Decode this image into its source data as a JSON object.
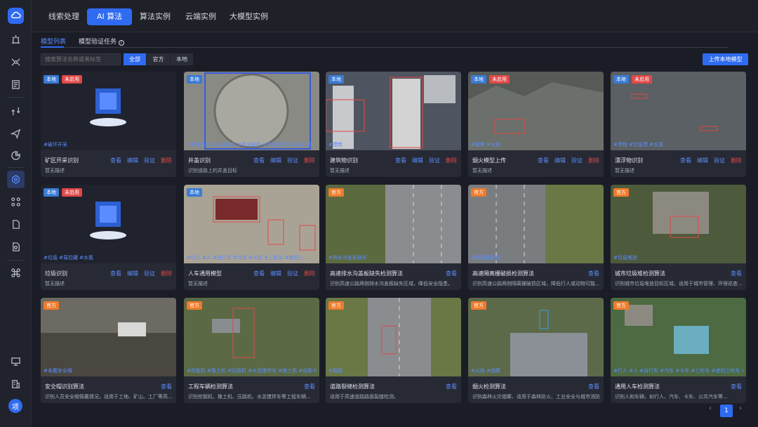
{
  "app": {
    "avatar": "项"
  },
  "topnav": [
    "线索处理",
    "AI 算法",
    "算法实例",
    "云端实例",
    "大模型实例"
  ],
  "subtabs": [
    "模型列表",
    "模型验证任务"
  ],
  "search": {
    "placeholder": "搜索算法名称或者标签"
  },
  "filters": [
    "全部",
    "官方",
    "本地"
  ],
  "upload_label": "上传本地模型",
  "badges": {
    "local": "本地",
    "disabled": "未启用",
    "official": "官方"
  },
  "actions": {
    "view": "查看",
    "edit": "编辑",
    "verify": "验证",
    "delete": "删除"
  },
  "cards": [
    {
      "name": "矿区开采识别",
      "desc": "暂无描述",
      "tags": "#破坏开采",
      "type": "local"
    },
    {
      "name": "井盖识别",
      "desc": "识别道路上的井盖目标",
      "tags": "#井盖移位 #井盖缺失 #井盖破损 #井盖损坏 #井盖开启",
      "type": "local"
    },
    {
      "name": "建筑物识别",
      "desc": "暂无描述",
      "tags": "#建筑",
      "type": "local"
    },
    {
      "name": "烟火模型上传",
      "desc": "暂无描述",
      "tags": "#烟雾 #火焰",
      "type": "local"
    },
    {
      "name": "漂浮物识别",
      "desc": "暂无描述",
      "tags": "#漂物 #垃圾漂 #水藻",
      "type": "local"
    },
    {
      "name": "垃圾识别",
      "desc": "暂无描述",
      "tags": "#垃圾 #易拉罐 #水瓶",
      "type": "local"
    },
    {
      "name": "人车通用模型",
      "desc": "暂无描述",
      "tags": "#行人 #人 #自行车 #汽车 #卡车 #三轮车 #遮阳三...",
      "type": "local"
    },
    {
      "name": "高速排水沟盖板缺失检测算法",
      "desc": "识别高速公路两侧排水沟盖板缺失区域，降低安全隐患。",
      "tags": "#排水沟盖板缺失",
      "type": "official"
    },
    {
      "name": "高速隔离栅破损检测算法",
      "desc": "识别高速公路两侧隔离栅破损区域，降低行人或动物可能...",
      "tags": "#隔离栅破损",
      "type": "official"
    },
    {
      "name": "城市垃圾堆检测算法",
      "desc": "识别城市垃圾堆放目标区域，适用于城市管理、环保巡查...",
      "tags": "#垃圾堆放",
      "type": "official"
    },
    {
      "name": "安全帽识别算法",
      "desc": "识别人员安全帽佩戴情况，适用于工地、矿山、工厂等高...",
      "tags": "#未戴安全帽",
      "type": "official"
    },
    {
      "name": "工程车辆检测算法",
      "desc": "识别挖掘机、推土机、压路机、水泥搅拌车等工程车辆...",
      "tags": "#挖掘机 #推土机 #压路机 #水泥搅拌车 #推土机 #自卸卡车",
      "type": "official"
    },
    {
      "name": "道路裂缝检测算法",
      "desc": "适用于高速道路路面裂缝检测。",
      "tags": "#裂缝",
      "type": "official"
    },
    {
      "name": "烟火检测算法",
      "desc": "识别森林火灾烟雾、适用于森林防火、工业安全与城市消防...",
      "tags": "#火焰 #烟雾",
      "type": "official"
    },
    {
      "name": "通用人车检测算法",
      "desc": "识别人和车辆，如行人、汽车、卡车、公共汽车等...",
      "tags": "#行人 #人 #自行车 #汽车 #卡车 #三轮车 #遮阳三轮车 #公交车",
      "type": "official"
    }
  ],
  "pager": {
    "current": "1",
    "prev": "‹",
    "next": "›"
  },
  "colors": {
    "accent": "#2f6bf0",
    "danger": "#e04848",
    "official": "#f07b2a"
  }
}
